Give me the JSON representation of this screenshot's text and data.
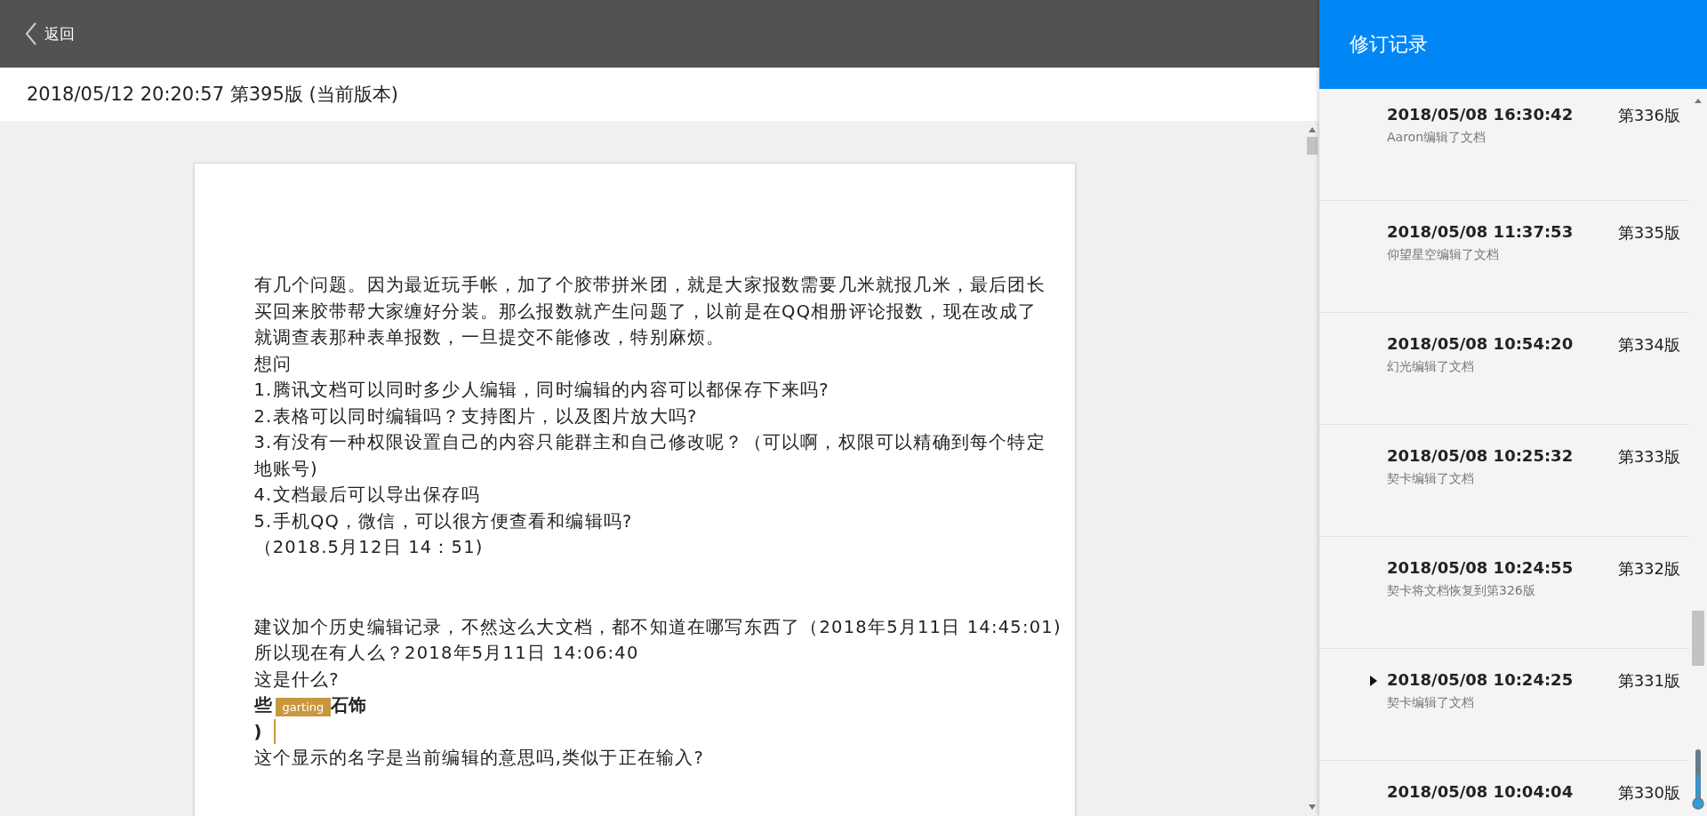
{
  "topbar": {
    "back_label": "返回"
  },
  "version_bar": {
    "title": "2018/05/12 20:20:57 第395版 (当前版本)"
  },
  "document": {
    "blocks": [
      {
        "lines": [
          {
            "text": "有几个问题。因为最近玩手帐，加了个胶带拼米团，就是大家报数需要几米就报几米，最后团长"
          },
          {
            "text": "买回来胶带帮大家缠好分装。那么报数就产生问题了，以前是在QQ相册评论报数，现在改成了"
          },
          {
            "text": "就调查表那种表单报数，一旦提交不能修改，特别麻烦。"
          },
          {
            "text": "想问"
          },
          {
            "text": "1.腾讯文档可以同时多少人编辑，同时编辑的内容可以都保存下来吗?"
          },
          {
            "text": "2.表格可以同时编辑吗？支持图片，以及图片放大吗?"
          },
          {
            "text": "3.有没有一种权限设置自己的内容只能群主和自己修改呢？（可以啊，权限可以精确到每个特定"
          },
          {
            "text": "地账号)"
          },
          {
            "text": "4.文档最后可以导出保存吗"
          },
          {
            "text": "5.手机QQ，微信，可以很方便查看和编辑吗?"
          },
          {
            "text": "（2018.5月12日 14：51)"
          }
        ]
      },
      {
        "lines": [
          {
            "text": "建议加个历史编辑记录，不然这么大文档，都不知道在哪写东西了（2018年5月11日 14:45:01)"
          },
          {
            "text": "所以现在有人么？2018年5月11日 14:06:40"
          },
          {
            "text": "这是什么?"
          },
          {
            "text": "些",
            "cursor": "garting",
            "after": "石饰",
            "bold": true
          },
          {
            "text": ")",
            "bold": true,
            "caret": true
          },
          {
            "text": "这个显示的名字是当前编辑的意思吗,类似于正在输入?"
          }
        ]
      }
    ]
  },
  "revisions": {
    "title": "修订记录",
    "items": [
      {
        "time": "2018/05/08 16:30:42",
        "version": "第336版",
        "description": "Aaron编辑了文档",
        "selected": false
      },
      {
        "time": "2018/05/08 11:37:53",
        "version": "第335版",
        "description": "仰望星空编辑了文档",
        "selected": false
      },
      {
        "time": "2018/05/08 10:54:20",
        "version": "第334版",
        "description": "幻光编辑了文档",
        "selected": false
      },
      {
        "time": "2018/05/08 10:25:32",
        "version": "第333版",
        "description": "契卡编辑了文档",
        "selected": false
      },
      {
        "time": "2018/05/08 10:24:55",
        "version": "第332版",
        "description": "契卡将文档恢复到第326版",
        "selected": false
      },
      {
        "time": "2018/05/08 10:24:25",
        "version": "第331版",
        "description": "契卡编辑了文档",
        "selected": true
      },
      {
        "time": "2018/05/08 10:04:04",
        "version": "第330版",
        "selected": false
      }
    ]
  }
}
